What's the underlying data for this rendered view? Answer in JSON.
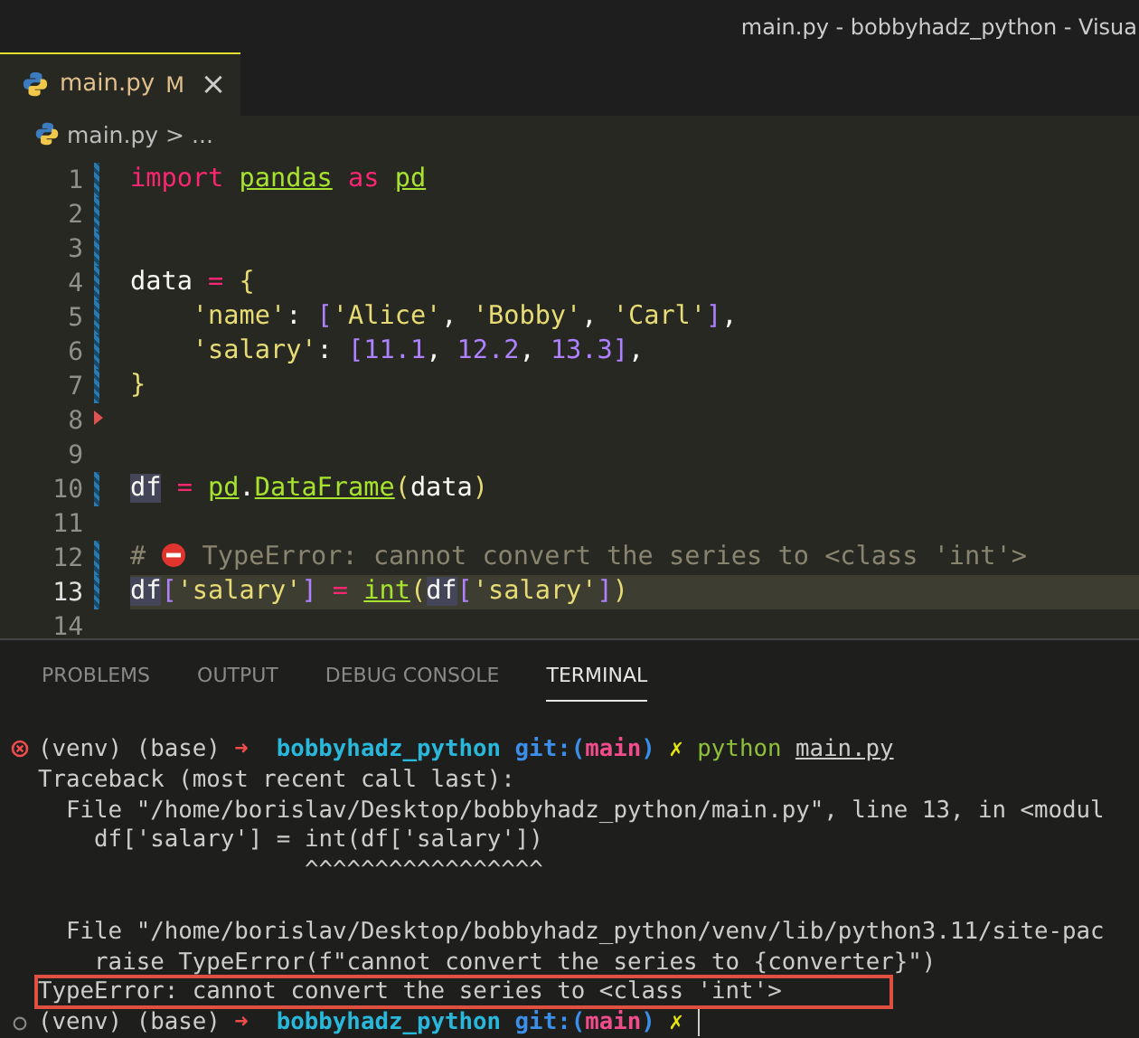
{
  "window": {
    "title": "main.py - bobbyhadz_python - Visua"
  },
  "tabs": [
    {
      "label": "main.py",
      "badge": "M",
      "close": "×",
      "selected": true
    }
  ],
  "breadcrumb": {
    "file": "main.py",
    "sep": ">",
    "rest": "..."
  },
  "editor": {
    "lines": [
      {
        "number": "1",
        "changed": true,
        "marker": false,
        "highlighted": false,
        "tokens": [
          {
            "text": "import ",
            "kind": "kw"
          },
          {
            "text": "pandas",
            "kind": "mod"
          },
          {
            "text": " as ",
            "kind": "kw"
          },
          {
            "text": "pd",
            "kind": "mod"
          }
        ]
      },
      {
        "number": "2",
        "changed": true,
        "marker": false,
        "highlighted": false
      },
      {
        "number": "3",
        "changed": true,
        "marker": false,
        "highlighted": false
      },
      {
        "number": "4",
        "changed": true,
        "marker": false,
        "highlighted": false,
        "tokens": [
          {
            "text": "data",
            "kind": "plain"
          },
          {
            "text": " = ",
            "kind": "op"
          },
          {
            "text": "{",
            "kind": "brace"
          }
        ]
      },
      {
        "number": "5",
        "changed": true,
        "marker": false,
        "highlighted": false,
        "tokens": [
          {
            "text": "    'name'",
            "kind": "str"
          },
          {
            "text": ": ",
            "kind": "plain"
          },
          {
            "text": "[",
            "kind": "bracket"
          },
          {
            "text": "'Alice'",
            "kind": "str"
          },
          {
            "text": ", ",
            "kind": "plain"
          },
          {
            "text": "'Bobby'",
            "kind": "str"
          },
          {
            "text": ", ",
            "kind": "plain"
          },
          {
            "text": "'Carl'",
            "kind": "str"
          },
          {
            "text": "]",
            "kind": "bracket"
          },
          {
            "text": ",",
            "kind": "plain"
          }
        ]
      },
      {
        "number": "6",
        "changed": true,
        "marker": false,
        "highlighted": false,
        "tokens": [
          {
            "text": "    'salary'",
            "kind": "str"
          },
          {
            "text": ": ",
            "kind": "plain"
          },
          {
            "text": "[",
            "kind": "bracket"
          },
          {
            "text": "11.1",
            "kind": "num"
          },
          {
            "text": ", ",
            "kind": "plain"
          },
          {
            "text": "12.2",
            "kind": "num"
          },
          {
            "text": ", ",
            "kind": "plain"
          },
          {
            "text": "13.3",
            "kind": "num"
          },
          {
            "text": "]",
            "kind": "bracket"
          },
          {
            "text": ",",
            "kind": "plain"
          }
        ]
      },
      {
        "number": "7",
        "changed": true,
        "marker": false,
        "highlighted": false,
        "tokens": [
          {
            "text": "}",
            "kind": "brace"
          }
        ]
      },
      {
        "number": "8",
        "changed": false,
        "marker": true,
        "highlighted": false
      },
      {
        "number": "9",
        "changed": false,
        "marker": false,
        "highlighted": false
      },
      {
        "number": "10",
        "changed": true,
        "marker": false,
        "highlighted": false,
        "tokens": [
          {
            "text": "df",
            "kind": "var"
          },
          {
            "text": " = ",
            "kind": "op"
          },
          {
            "text": "pd",
            "kind": "mod"
          },
          {
            "text": ".",
            "kind": "plain"
          },
          {
            "text": "DataFrame",
            "kind": "fn"
          },
          {
            "text": "(",
            "kind": "brace"
          },
          {
            "text": "data",
            "kind": "plain"
          },
          {
            "text": ")",
            "kind": "brace"
          }
        ]
      },
      {
        "number": "11",
        "changed": false,
        "marker": false,
        "highlighted": false
      },
      {
        "number": "12",
        "changed": true,
        "marker": false,
        "highlighted": false,
        "tokens": [
          {
            "text": "#",
            "kind": "comment"
          },
          {
            "kind": "stop-icon"
          },
          {
            "text": "TypeError: cannot convert the series to <class 'int'>",
            "kind": "comment"
          }
        ]
      },
      {
        "number": "13",
        "changed": true,
        "marker": false,
        "highlighted": true,
        "tokens": [
          {
            "text": "df",
            "kind": "var"
          },
          {
            "text": "[",
            "kind": "bracket"
          },
          {
            "text": "'salary'",
            "kind": "str"
          },
          {
            "text": "]",
            "kind": "bracket"
          },
          {
            "text": " = ",
            "kind": "op"
          },
          {
            "text": "int",
            "kind": "fn"
          },
          {
            "text": "(",
            "kind": "brace"
          },
          {
            "text": "df",
            "kind": "var"
          },
          {
            "text": "[",
            "kind": "bracket"
          },
          {
            "text": "'salary'",
            "kind": "str"
          },
          {
            "text": "]",
            "kind": "bracket"
          },
          {
            "text": ")",
            "kind": "brace"
          }
        ]
      },
      {
        "number": "14",
        "changed": false,
        "marker": false,
        "highlighted": false
      }
    ]
  },
  "panel": {
    "tabs": [
      {
        "label": "PROBLEMS",
        "selected": false
      },
      {
        "label": "OUTPUT",
        "selected": false
      },
      {
        "label": "DEBUG CONSOLE",
        "selected": false
      },
      {
        "label": "TERMINAL",
        "selected": true
      }
    ],
    "terminal": [
      {
        "kind": "error-prompt",
        "segments": [
          {
            "text": "(venv) (base)",
            "kind": "plain"
          },
          {
            "text": "➜",
            "kind": "arrow"
          },
          {
            "text": "bobbyhadz_python",
            "kind": "dir"
          },
          {
            "text": "git:(",
            "kind": "git"
          },
          {
            "text": "main",
            "kind": "branch"
          },
          {
            "text": ")",
            "kind": "git"
          },
          {
            "text": "✗",
            "kind": "dirty"
          },
          {
            "text": "python",
            "kind": "cmd"
          },
          {
            "text": "main.py",
            "kind": "arg"
          }
        ]
      },
      {
        "kind": "output",
        "segments": [
          {
            "text": "Traceback (most recent call last):",
            "kind": "plain"
          }
        ]
      },
      {
        "kind": "output",
        "segments": [
          {
            "text": "  File \"/home/borislav/Desktop/bobbyhadz_python/main.py\", line 13, in <modul",
            "kind": "plain"
          }
        ]
      },
      {
        "kind": "output",
        "segments": [
          {
            "text": "    df['salary'] = int(df['salary'])",
            "kind": "plain"
          }
        ]
      },
      {
        "kind": "output",
        "segments": [
          {
            "text": "                   ^^^^^^^^^^^^^^^^^",
            "kind": "plain"
          }
        ]
      },
      {
        "kind": "output"
      },
      {
        "kind": "output",
        "segments": [
          {
            "text": "  File \"/home/borislav/Desktop/bobbyhadz_python/venv/lib/python3.11/site-pac",
            "kind": "plain"
          }
        ]
      },
      {
        "kind": "output",
        "segments": [
          {
            "text": "    raise TypeError(f\"cannot convert the series to {converter}\")",
            "kind": "plain"
          }
        ]
      },
      {
        "kind": "error-output",
        "segments": [
          {
            "text": "TypeError: cannot convert the series to <class 'int'>",
            "kind": "plain"
          }
        ]
      },
      {
        "kind": "idle-prompt",
        "segments": [
          {
            "text": "(venv) (base)",
            "kind": "plain"
          },
          {
            "text": "➜",
            "kind": "arrow"
          },
          {
            "text": "bobbyhadz_python",
            "kind": "dir"
          },
          {
            "text": "git:(",
            "kind": "git"
          },
          {
            "text": "main",
            "kind": "branch"
          },
          {
            "text": ")",
            "kind": "git"
          },
          {
            "text": "✗",
            "kind": "dirty"
          },
          {
            "kind": "cursor"
          }
        ]
      }
    ]
  }
}
